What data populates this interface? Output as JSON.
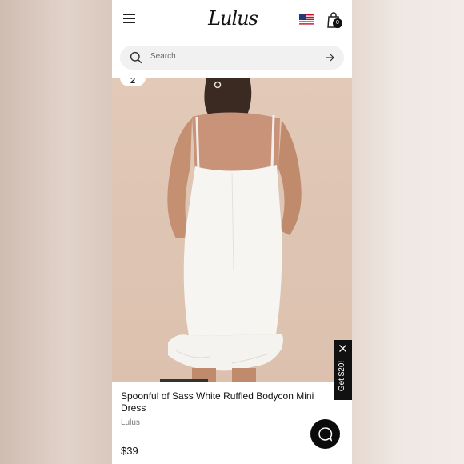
{
  "header": {
    "logo_text": "Lulus",
    "bag_count": "0",
    "icons": {
      "menu": "hamburger-menu-icon",
      "flag": "us-flag-icon",
      "bag": "shopping-bag-icon"
    }
  },
  "search": {
    "placeholder": "Search",
    "icons": {
      "search": "search-icon",
      "submit": "arrow-right-icon"
    }
  },
  "product": {
    "slide_number": "2",
    "title": "Spoonful of Sass White Ruffled Bodycon Mini Dress",
    "brand": "Lulus",
    "price": "$39"
  },
  "promo": {
    "label": "Get $20!",
    "close_icon": "close-icon"
  },
  "chat": {
    "icon": "chat-bubble-icon"
  },
  "colors": {
    "accent": "#111111",
    "image_background": "#dec5b3",
    "search_background": "#f1f1f1"
  }
}
